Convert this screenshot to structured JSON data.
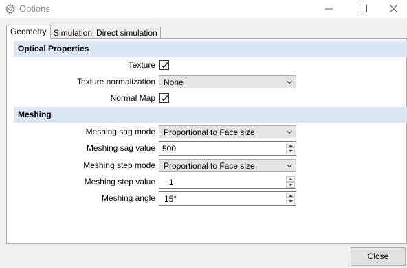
{
  "window": {
    "title": "Options",
    "app_icon": "gear-icon",
    "controls": [
      "minimize-icon",
      "maximize-icon",
      "close-icon"
    ]
  },
  "tabs": [
    {
      "label": "Geometry",
      "active": true
    },
    {
      "label": "Simulation",
      "active": false
    },
    {
      "label": "Direct simulation",
      "active": false
    }
  ],
  "optical": {
    "header": "Optical Properties",
    "texture": {
      "label": "Texture",
      "checked": true
    },
    "texture_normalization": {
      "label": "Texture normalization",
      "value": "None"
    },
    "normal_map": {
      "label": "Normal Map",
      "checked": true
    }
  },
  "meshing": {
    "header": "Meshing",
    "sag_mode": {
      "label": "Meshing sag mode",
      "value": "Proportional to Face size"
    },
    "sag_value": {
      "label": "Meshing sag value",
      "value": "500"
    },
    "step_mode": {
      "label": "Meshing step mode",
      "value": "Proportional to Face size"
    },
    "step_value": {
      "label": "Meshing step value",
      "value": "1"
    },
    "angle": {
      "label": "Meshing angle",
      "value": "15°"
    }
  },
  "footer": {
    "close_label": "Close"
  },
  "colors": {
    "group_header_bg": "#dbe6f4",
    "panel_bg": "#ffffff",
    "dialog_bg": "#f0f0f0"
  }
}
